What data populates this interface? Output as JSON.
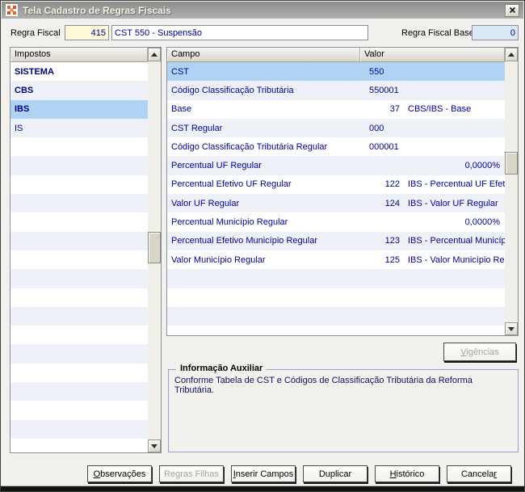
{
  "window": {
    "title": "Tela Cadastro de Regras Fiscais",
    "close_icon": "close-x"
  },
  "header": {
    "regra_fiscal_label": "Regra Fiscal",
    "regra_fiscal_numero": "415",
    "regra_fiscal_descricao": "CST 550 - Suspensão",
    "regra_fiscal_base_label": "Regra Fiscal Base",
    "regra_fiscal_base_valor": "0"
  },
  "impostos": {
    "header": "Impostos",
    "items": [
      {
        "label": "SISTEMA",
        "bold": true,
        "selected": false
      },
      {
        "label": "CBS",
        "bold": true,
        "selected": false
      },
      {
        "label": "IBS",
        "bold": true,
        "selected": true
      },
      {
        "label": "IS",
        "bold": false,
        "selected": false
      }
    ]
  },
  "campos": {
    "col_campo": "Campo",
    "col_valor": "Valor",
    "rows": [
      {
        "campo": "CST",
        "tipo": "code",
        "valor": "550",
        "selected": true
      },
      {
        "campo": "Código Classificação Tributária",
        "tipo": "code",
        "valor": "550001"
      },
      {
        "campo": "Base",
        "tipo": "ref",
        "num": "37",
        "desc": "CBS/IBS - Base"
      },
      {
        "campo": "CST Regular",
        "tipo": "code",
        "valor": "000"
      },
      {
        "campo": "Código Classificação Tributária Regular",
        "tipo": "code",
        "valor": "000001"
      },
      {
        "campo": "Percentual UF Regular",
        "tipo": "percent",
        "valor": "0,0000%"
      },
      {
        "campo": "Percentual Efetivo UF Regular",
        "tipo": "ref",
        "num": "122",
        "desc": "IBS - Percentual UF Efetivo R"
      },
      {
        "campo": "Valor UF Regular",
        "tipo": "ref",
        "num": "124",
        "desc": "IBS - Valor UF Regular"
      },
      {
        "campo": "Percentual Município Regular",
        "tipo": "percent",
        "valor": "0,0000%"
      },
      {
        "campo": "Percentual Efetivo Município Regular",
        "tipo": "ref",
        "num": "123",
        "desc": "IBS - Percentual Município Efe"
      },
      {
        "campo": "Valor Município Regular",
        "tipo": "ref",
        "num": "125",
        "desc": "IBS - Valor Município Regular"
      }
    ]
  },
  "vigencias_button": {
    "label": "&Vigências",
    "enabled": false
  },
  "info_auxiliar": {
    "titulo": "Informação Auxiliar",
    "texto": "Conforme Tabela de CST e Códigos de Classificação Tributária da Reforma Tributária."
  },
  "buttons": [
    {
      "label": "&Observações",
      "enabled": true
    },
    {
      "label": "Regras Filhas",
      "enabled": false
    },
    {
      "label": "&Inserir Campos",
      "enabled": true
    },
    {
      "label": "Duplicar",
      "enabled": true
    },
    {
      "label": "&Histórico",
      "enabled": true
    },
    {
      "label": "Cancela&r",
      "enabled": true
    }
  ],
  "colors": {
    "selection_blue": "#AFD3F2",
    "row_stripe": "#EFF1F8",
    "value_text_navy": "#0000A0",
    "bold_item_navy": "#000080",
    "field_yellow": "#FCF9D8",
    "field_light_blue": "#DCE9F6",
    "titlebar_gray": "#9A9A9A",
    "icon_orange": "#E8622C"
  }
}
